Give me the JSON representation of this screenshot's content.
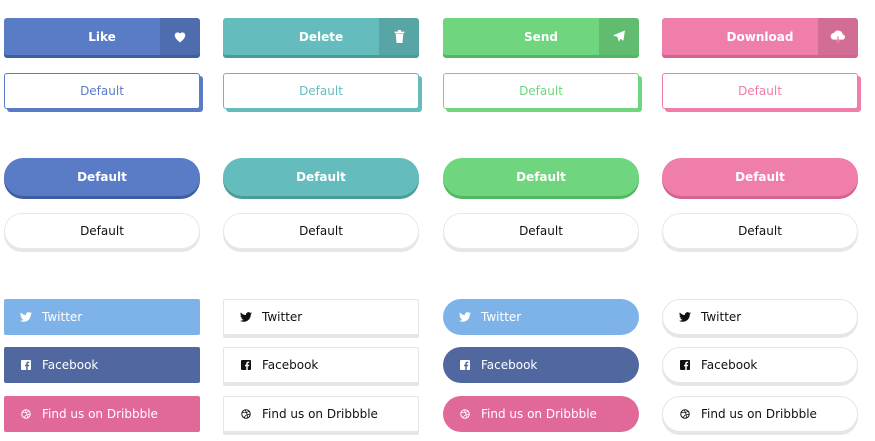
{
  "colors": {
    "blue": "#5a7bc6",
    "teal": "#64bdbc",
    "green": "#6fd67f",
    "pink": "#ef7eaa",
    "twitter": "#7eb3ea",
    "facebook": "#51679f",
    "dribbble": "#e1699a"
  },
  "row1": [
    {
      "label": "Like",
      "icon": "heart-icon"
    },
    {
      "label": "Delete",
      "icon": "trash-icon"
    },
    {
      "label": "Send",
      "icon": "paper-plane-icon"
    },
    {
      "label": "Download",
      "icon": "cloud-download-icon"
    }
  ],
  "row2": [
    "Default",
    "Default",
    "Default",
    "Default"
  ],
  "row3": [
    "Default",
    "Default",
    "Default",
    "Default"
  ],
  "row4": [
    "Default",
    "Default",
    "Default",
    "Default"
  ],
  "social": {
    "twitter": "Twitter",
    "facebook": "Facebook",
    "dribbble": "Find us on Dribbble"
  }
}
